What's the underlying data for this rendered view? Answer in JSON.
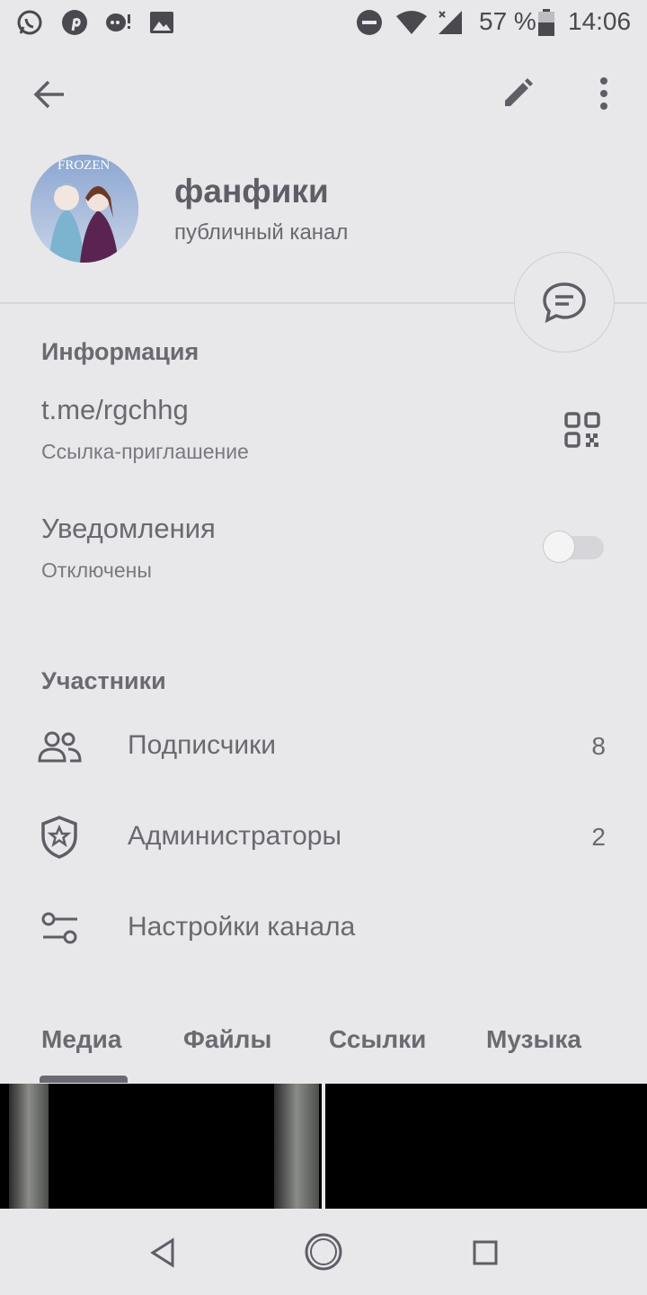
{
  "status_bar": {
    "battery": "57 %",
    "time": "14:06",
    "icons": [
      "whatsapp-icon",
      "pinterest-icon",
      "chat-notification-icon",
      "image-icon",
      "dnd-icon",
      "wifi-icon",
      "signal-icon",
      "battery-icon"
    ]
  },
  "header": {
    "icons": [
      "back-arrow-icon",
      "edit-pencil-icon",
      "more-vert-icon"
    ]
  },
  "channel": {
    "avatar_text": "FROZEN",
    "name": "фанфики",
    "type": "публичный канал"
  },
  "info": {
    "section_title": "Информация",
    "link": "t.me/rgchhg",
    "link_caption": "Ссылка-приглашение",
    "notifications_label": "Уведомления",
    "notifications_state": "Отключены",
    "notifications_enabled": false
  },
  "members": {
    "section_title": "Участники",
    "rows": [
      {
        "label": "Подписчики",
        "count": "8",
        "icon": "people-icon"
      },
      {
        "label": "Администраторы",
        "count": "2",
        "icon": "admin-shield-icon"
      },
      {
        "label": "Настройки канала",
        "count": "",
        "icon": "settings-sliders-icon"
      }
    ]
  },
  "tabs": [
    "Медиа",
    "Файлы",
    "Ссылки",
    "Музыка"
  ],
  "active_tab": "Медиа",
  "colors": {
    "background": "#e8e7ea",
    "text": "#6a6970",
    "accent": "#6b6a71"
  }
}
